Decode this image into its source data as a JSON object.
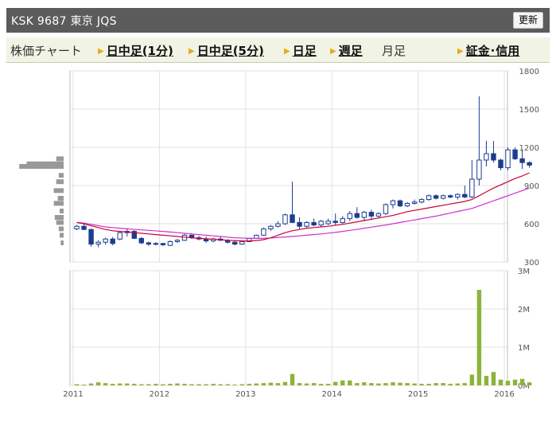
{
  "header": {
    "title": "KSK  9687  東京 JQS",
    "refresh_label": "更新"
  },
  "tabs": [
    {
      "label": "株価チャート",
      "link": false,
      "arrow": false
    },
    {
      "label": "日中足(1分)",
      "link": true,
      "arrow": true
    },
    {
      "label": "日中足(5分)",
      "link": true,
      "arrow": true
    },
    {
      "label": "日足",
      "link": true,
      "arrow": true
    },
    {
      "label": "週足",
      "link": true,
      "arrow": true
    },
    {
      "label": "月足",
      "link": false,
      "arrow": false
    },
    {
      "label": "証金･信用",
      "link": true,
      "arrow": true
    }
  ],
  "colors": {
    "up_candle": "#ffffff",
    "down_candle": "#1d3c8f",
    "candle_outline": "#1d3c8f",
    "ma_short": "#cc0033",
    "ma_long": "#cc33cc",
    "volume": "#8cb33c",
    "price_profile": "#999999",
    "grid": "#e0e0e0"
  },
  "chart_data": [
    {
      "type": "candlestick",
      "ylim": [
        300,
        1800
      ],
      "yticks": [
        "300",
        "600",
        "900",
        "1200",
        "1500",
        "1800"
      ],
      "xticks": [
        "2011",
        "2012",
        "2013",
        "2014",
        "2015",
        "2016"
      ],
      "x_start": "2011-01",
      "candles": [
        {
          "o": 560,
          "h": 590,
          "l": 550,
          "c": 580
        },
        {
          "o": 580,
          "h": 600,
          "l": 550,
          "c": 555
        },
        {
          "o": 555,
          "h": 560,
          "l": 420,
          "c": 440
        },
        {
          "o": 440,
          "h": 470,
          "l": 415,
          "c": 455
        },
        {
          "o": 455,
          "h": 490,
          "l": 435,
          "c": 480
        },
        {
          "o": 480,
          "h": 495,
          "l": 430,
          "c": 445
        },
        {
          "o": 480,
          "h": 545,
          "l": 470,
          "c": 530
        },
        {
          "o": 530,
          "h": 565,
          "l": 500,
          "c": 540
        },
        {
          "o": 540,
          "h": 550,
          "l": 480,
          "c": 485
        },
        {
          "o": 485,
          "h": 495,
          "l": 440,
          "c": 450
        },
        {
          "o": 450,
          "h": 460,
          "l": 425,
          "c": 440
        },
        {
          "o": 440,
          "h": 455,
          "l": 430,
          "c": 445
        },
        {
          "o": 445,
          "h": 450,
          "l": 425,
          "c": 435
        },
        {
          "o": 430,
          "h": 470,
          "l": 425,
          "c": 460
        },
        {
          "o": 460,
          "h": 480,
          "l": 450,
          "c": 470
        },
        {
          "o": 470,
          "h": 520,
          "l": 465,
          "c": 510
        },
        {
          "o": 510,
          "h": 520,
          "l": 480,
          "c": 490
        },
        {
          "o": 490,
          "h": 505,
          "l": 470,
          "c": 480
        },
        {
          "o": 480,
          "h": 500,
          "l": 450,
          "c": 465
        },
        {
          "o": 465,
          "h": 490,
          "l": 455,
          "c": 480
        },
        {
          "o": 480,
          "h": 500,
          "l": 465,
          "c": 470
        },
        {
          "o": 470,
          "h": 480,
          "l": 445,
          "c": 455
        },
        {
          "o": 455,
          "h": 470,
          "l": 430,
          "c": 440
        },
        {
          "o": 440,
          "h": 470,
          "l": 435,
          "c": 460
        },
        {
          "o": 460,
          "h": 490,
          "l": 455,
          "c": 485
        },
        {
          "o": 485,
          "h": 515,
          "l": 480,
          "c": 510
        },
        {
          "o": 510,
          "h": 570,
          "l": 505,
          "c": 560
        },
        {
          "o": 560,
          "h": 590,
          "l": 545,
          "c": 580
        },
        {
          "o": 580,
          "h": 620,
          "l": 570,
          "c": 600
        },
        {
          "o": 600,
          "h": 680,
          "l": 590,
          "c": 670
        },
        {
          "o": 670,
          "h": 930,
          "l": 640,
          "c": 610
        },
        {
          "o": 610,
          "h": 650,
          "l": 560,
          "c": 580
        },
        {
          "o": 580,
          "h": 620,
          "l": 570,
          "c": 610
        },
        {
          "o": 610,
          "h": 640,
          "l": 580,
          "c": 590
        },
        {
          "o": 590,
          "h": 630,
          "l": 575,
          "c": 620
        },
        {
          "o": 600,
          "h": 640,
          "l": 590,
          "c": 620
        },
        {
          "o": 620,
          "h": 680,
          "l": 590,
          "c": 610
        },
        {
          "o": 610,
          "h": 660,
          "l": 600,
          "c": 640
        },
        {
          "o": 640,
          "h": 700,
          "l": 620,
          "c": 680
        },
        {
          "o": 680,
          "h": 730,
          "l": 640,
          "c": 650
        },
        {
          "o": 650,
          "h": 700,
          "l": 620,
          "c": 690
        },
        {
          "o": 690,
          "h": 710,
          "l": 630,
          "c": 660
        },
        {
          "o": 660,
          "h": 690,
          "l": 640,
          "c": 680
        },
        {
          "o": 680,
          "h": 760,
          "l": 670,
          "c": 750
        },
        {
          "o": 750,
          "h": 790,
          "l": 720,
          "c": 780
        },
        {
          "o": 780,
          "h": 790,
          "l": 730,
          "c": 740
        },
        {
          "o": 740,
          "h": 770,
          "l": 730,
          "c": 760
        },
        {
          "o": 760,
          "h": 790,
          "l": 750,
          "c": 770
        },
        {
          "o": 770,
          "h": 800,
          "l": 760,
          "c": 790
        },
        {
          "o": 790,
          "h": 830,
          "l": 780,
          "c": 820
        },
        {
          "o": 820,
          "h": 830,
          "l": 790,
          "c": 800
        },
        {
          "o": 800,
          "h": 830,
          "l": 790,
          "c": 820
        },
        {
          "o": 820,
          "h": 830,
          "l": 800,
          "c": 810
        },
        {
          "o": 810,
          "h": 840,
          "l": 790,
          "c": 830
        },
        {
          "o": 830,
          "h": 900,
          "l": 800,
          "c": 810
        },
        {
          "o": 810,
          "h": 1100,
          "l": 800,
          "c": 950
        },
        {
          "o": 950,
          "h": 1600,
          "l": 900,
          "c": 1100
        },
        {
          "o": 1100,
          "h": 1250,
          "l": 1050,
          "c": 1150
        },
        {
          "o": 1150,
          "h": 1250,
          "l": 1080,
          "c": 1100
        },
        {
          "o": 1100,
          "h": 1110,
          "l": 1020,
          "c": 1040
        },
        {
          "o": 1040,
          "h": 1200,
          "l": 1020,
          "c": 1180
        },
        {
          "o": 1180,
          "h": 1200,
          "l": 1100,
          "c": 1110
        },
        {
          "o": 1110,
          "h": 1180,
          "l": 1030,
          "c": 1080
        },
        {
          "o": 1080,
          "h": 1090,
          "l": 1040,
          "c": 1060
        }
      ],
      "ma_short": [
        610,
        600,
        585,
        570,
        555,
        545,
        540,
        535,
        530,
        525,
        520,
        515,
        510,
        505,
        500,
        495,
        490,
        485,
        482,
        478,
        475,
        470,
        468,
        465,
        465,
        468,
        475,
        490,
        510,
        530,
        545,
        555,
        565,
        570,
        575,
        580,
        588,
        595,
        605,
        615,
        625,
        635,
        645,
        655,
        665,
        680,
        695,
        705,
        715,
        725,
        735,
        745,
        755,
        765,
        775,
        790,
        820,
        850,
        880,
        905,
        930,
        955,
        975,
        1000
      ],
      "ma_long": [
        610,
        605,
        595,
        585,
        575,
        570,
        565,
        560,
        556,
        552,
        548,
        544,
        540,
        535,
        530,
        525,
        520,
        515,
        510,
        505,
        500,
        495,
        490,
        488,
        486,
        485,
        486,
        488,
        492,
        496,
        500,
        505,
        510,
        515,
        520,
        526,
        532,
        540,
        548,
        556,
        565,
        573,
        582,
        590,
        600,
        610,
        620,
        630,
        640,
        650,
        660,
        672,
        684,
        696,
        708,
        720,
        740,
        760,
        780,
        800,
        820,
        840,
        860,
        880
      ],
      "volume_profile": [
        {
          "price": 1110,
          "weight": 0.15
        },
        {
          "price": 1070,
          "weight": 0.75
        },
        {
          "price": 1050,
          "weight": 0.9
        },
        {
          "price": 980,
          "weight": 0.1
        },
        {
          "price": 930,
          "weight": 0.15
        },
        {
          "price": 860,
          "weight": 0.2
        },
        {
          "price": 800,
          "weight": 0.12
        },
        {
          "price": 760,
          "weight": 0.2
        },
        {
          "price": 700,
          "weight": 0.08
        },
        {
          "price": 650,
          "weight": 0.18
        },
        {
          "price": 610,
          "weight": 0.15
        },
        {
          "price": 560,
          "weight": 0.1
        },
        {
          "price": 510,
          "weight": 0.08
        },
        {
          "price": 450,
          "weight": 0.06
        }
      ]
    },
    {
      "type": "bar",
      "ylabel": "",
      "ylim": [
        0,
        3000000
      ],
      "yticks": [
        "0M",
        "1M",
        "2M",
        "3M"
      ],
      "volume": [
        30000,
        20000,
        50000,
        80000,
        60000,
        40000,
        50000,
        50000,
        40000,
        30000,
        30000,
        40000,
        30000,
        40000,
        50000,
        40000,
        30000,
        30000,
        30000,
        40000,
        30000,
        30000,
        20000,
        30000,
        40000,
        50000,
        60000,
        70000,
        60000,
        90000,
        300000,
        60000,
        50000,
        60000,
        40000,
        40000,
        90000,
        130000,
        130000,
        60000,
        80000,
        60000,
        50000,
        60000,
        80000,
        70000,
        60000,
        50000,
        40000,
        40000,
        60000,
        60000,
        40000,
        50000,
        60000,
        280000,
        2500000,
        250000,
        350000,
        150000,
        120000,
        150000,
        170000,
        80000
      ]
    }
  ]
}
